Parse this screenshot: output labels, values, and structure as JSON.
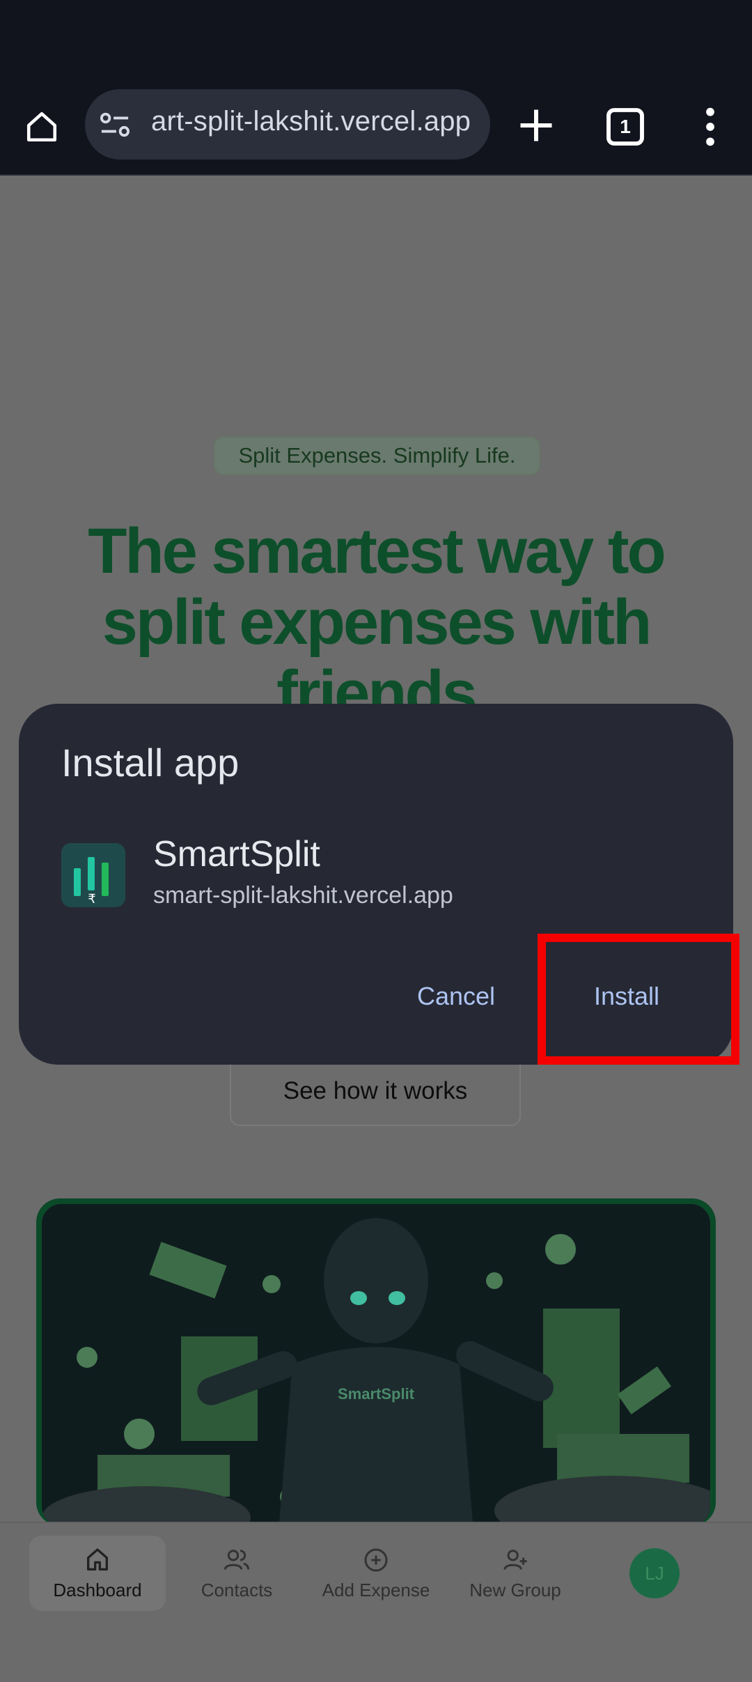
{
  "browser": {
    "url": "smart-split-lakshit.vercel.app",
    "url_visible": "art-split-lakshit.vercel.app",
    "tab_count": "1"
  },
  "page": {
    "tagline": "Split Expenses. Simplify Life.",
    "hero_title": "The smartest way to split expenses with friends",
    "see_how_label": "See how it works",
    "hero_logo_text": "SmartSplit"
  },
  "bottom_nav": {
    "items": [
      {
        "label": "Dashboard",
        "icon": "home-icon"
      },
      {
        "label": "Contacts",
        "icon": "users-icon"
      },
      {
        "label": "Add Expense",
        "icon": "plus-circle-icon"
      },
      {
        "label": "New Group",
        "icon": "user-plus-icon"
      }
    ],
    "avatar_initials": "LJ"
  },
  "dialog": {
    "title": "Install app",
    "app_name": "SmartSplit",
    "app_url": "smart-split-lakshit.vercel.app",
    "cancel_label": "Cancel",
    "install_label": "Install"
  },
  "colors": {
    "highlight": "#f40000",
    "dialog_bg": "#262934",
    "button_text": "#aec4f2",
    "brand_green": "#0d4f2a"
  }
}
